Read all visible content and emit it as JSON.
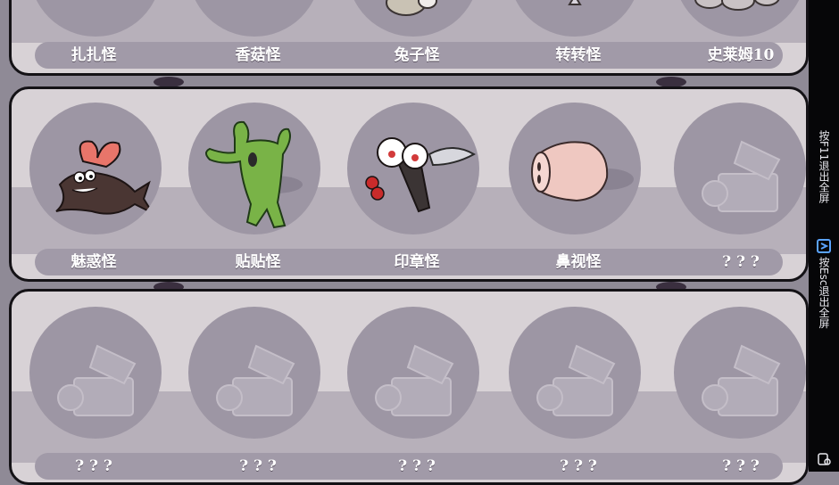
{
  "rows": [
    {
      "labels": [
        "扎扎怪",
        "香菇怪",
        "兔子怪",
        "转转怪",
        "史莱姆10"
      ]
    },
    {
      "labels": [
        "魅惑怪",
        "贴贴怪",
        "印章怪",
        "鼻视怪",
        "? ? ?"
      ]
    },
    {
      "labels": [
        "? ? ?",
        "? ? ?",
        "? ? ?",
        "? ? ?",
        "? ? ?"
      ]
    }
  ],
  "sidebar": {
    "exit_f11": "按F11退出全屏",
    "exit_esc": "按Esc退出全屏"
  }
}
